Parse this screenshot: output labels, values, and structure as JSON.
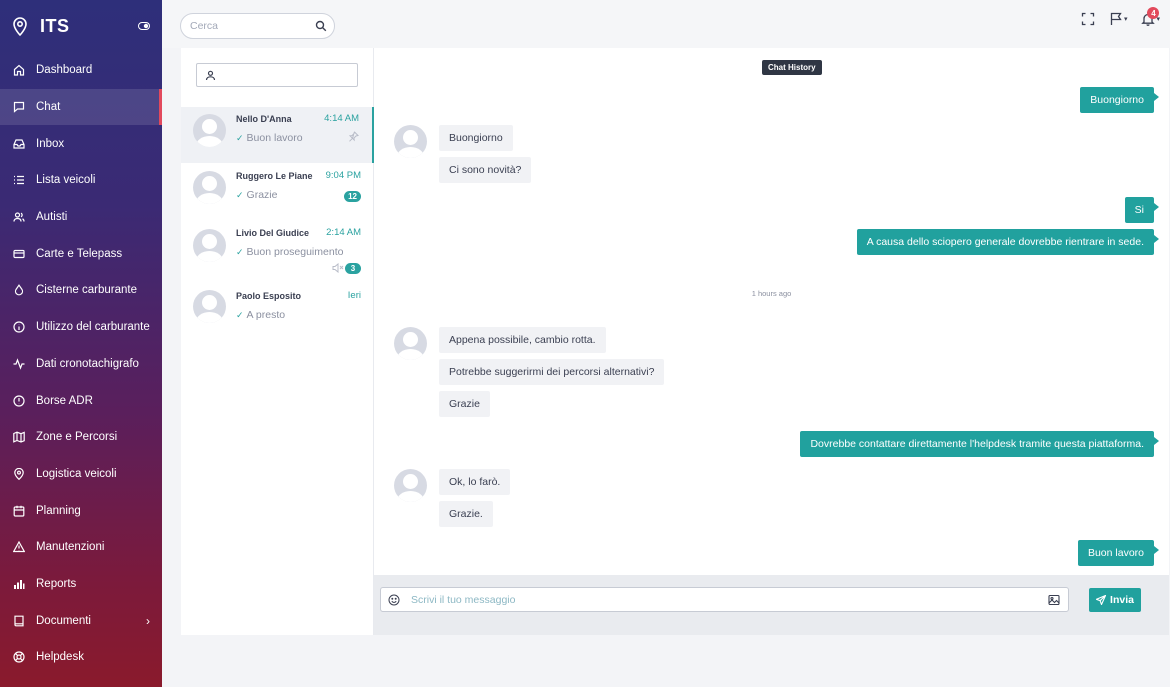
{
  "brand": {
    "title": "ITS"
  },
  "topbar": {
    "search_placeholder": "Cerca",
    "notification_count": "4"
  },
  "sidebar": {
    "items": [
      {
        "label": "Dashboard",
        "icon": "home-icon"
      },
      {
        "label": "Chat",
        "icon": "chat-icon",
        "active": true
      },
      {
        "label": "Inbox",
        "icon": "inbox-icon"
      },
      {
        "label": "Lista veicoli",
        "icon": "list-icon"
      },
      {
        "label": "Autisti",
        "icon": "users-icon"
      },
      {
        "label": "Carte e Telepass",
        "icon": "card-icon"
      },
      {
        "label": "Cisterne carburante",
        "icon": "droplet-icon"
      },
      {
        "label": "Utilizzo del carburante",
        "icon": "info-icon"
      },
      {
        "label": "Dati cronotachigrafo",
        "icon": "activity-icon"
      },
      {
        "label": "Borse ADR",
        "icon": "alert-circle-icon"
      },
      {
        "label": "Zone e Percorsi",
        "icon": "map-icon"
      },
      {
        "label": "Logistica veicoli",
        "icon": "location-icon"
      },
      {
        "label": "Planning",
        "icon": "calendar-icon"
      },
      {
        "label": "Manutenzioni",
        "icon": "warning-icon"
      },
      {
        "label": "Reports",
        "icon": "bar-chart-icon"
      },
      {
        "label": "Documenti",
        "icon": "book-icon"
      },
      {
        "label": "Helpdesk",
        "icon": "lifebuoy-icon"
      }
    ]
  },
  "contacts": [
    {
      "name": "Nello D'Anna",
      "time": "4:14 AM",
      "last": "Buon lavoro",
      "badge": "",
      "pinned": true
    },
    {
      "name": "Ruggero Le Piane",
      "time": "9:04 PM",
      "last": "Grazie",
      "badge": "12"
    },
    {
      "name": "Livio Del Giudice",
      "time": "2:14 AM",
      "last": "Buon proseguimento",
      "badge": "3",
      "muted": true
    },
    {
      "name": "Paolo Esposito",
      "time": "Ieri",
      "last": "A presto",
      "badge": ""
    }
  ],
  "chat": {
    "title": "Chat History",
    "separator": "1 hours ago",
    "messages": {
      "out1": "Buongiorno",
      "in1": "Buongiorno",
      "in2": "Ci sono novità?",
      "out2": "Si",
      "out3": "A causa dello sciopero generale dovrebbe rientrare in sede.",
      "in3": "Appena possibile, cambio rotta.",
      "in4": "Potrebbe suggerirmi dei percorsi alternativi?",
      "in5": "Grazie",
      "out4": "Dovrebbe contattare direttamente l'helpdesk tramite questa piattaforma.",
      "in6": "Ok, lo farò.",
      "in7": "Grazie.",
      "out5": "Buon lavoro"
    }
  },
  "composer": {
    "placeholder": "Scrivi il tuo messaggio",
    "send_label": "Invia"
  },
  "colors": {
    "accent": "#21a19e",
    "danger": "#e24a5c",
    "sidebar_top": "#2e2f7a",
    "sidebar_bottom": "#8a1a2c"
  }
}
